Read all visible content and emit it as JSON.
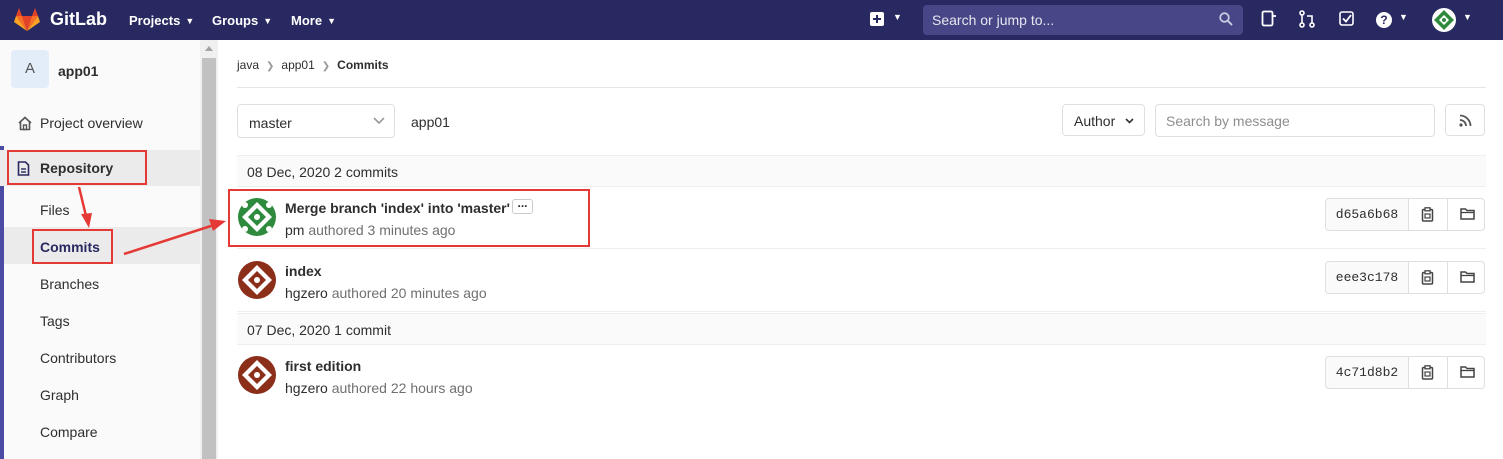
{
  "topnav": {
    "brand": "GitLab",
    "projects": "Projects",
    "groups": "Groups",
    "more": "More",
    "search_placeholder": "Search or jump to..."
  },
  "sidebar": {
    "project_initial": "A",
    "project_name": "app01",
    "overview": "Project overview",
    "repository": "Repository",
    "sub_items": [
      "Files",
      "Commits",
      "Branches",
      "Tags",
      "Contributors",
      "Graph",
      "Compare"
    ]
  },
  "breadcrumb": [
    "java",
    "app01",
    "Commits"
  ],
  "filters": {
    "branch": "master",
    "path": "app01",
    "author_label": "Author",
    "search_placeholder": "Search by message"
  },
  "days": [
    {
      "header": "08 Dec, 2020 2 commits",
      "commits": [
        {
          "title": "Merge branch 'index' into 'master'",
          "author": "pm",
          "authored": "authored",
          "when": "3 minutes ago",
          "sha": "d65a6b68",
          "avatar_color": "#2e8b3e",
          "has_ellipsis": true
        },
        {
          "title": "index",
          "author": "hgzero",
          "authored": "authored",
          "when": "20 minutes ago",
          "sha": "eee3c178",
          "avatar_color": "#8b2e1a",
          "has_ellipsis": false
        }
      ]
    },
    {
      "header": "07 Dec, 2020 1 commit",
      "commits": [
        {
          "title": "first edition",
          "author": "hgzero",
          "authored": "authored",
          "when": "22 hours ago",
          "sha": "4c71d8b2",
          "avatar_color": "#8b2e1a",
          "has_ellipsis": false
        }
      ]
    }
  ],
  "colors": {
    "nav_bg": "#292961",
    "accent": "#4b4ba3",
    "annotation": "#e53935"
  }
}
